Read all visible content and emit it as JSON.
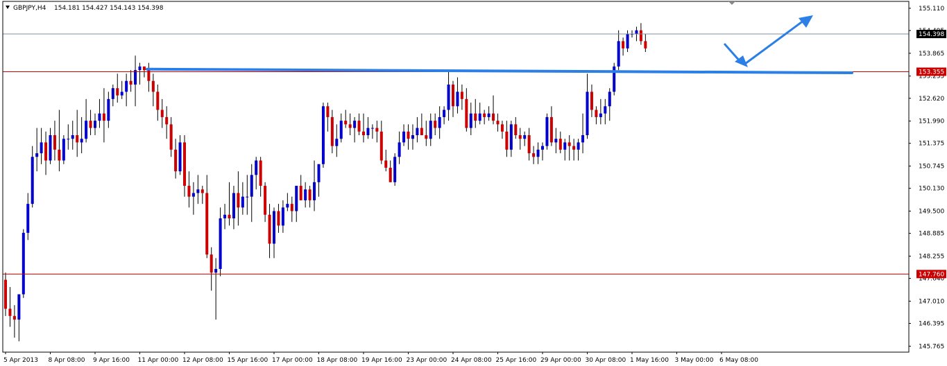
{
  "header": {
    "symbol_tf": "GBPJPY,H4",
    "ohlc": "154.181 154.427 154.143 154.398"
  },
  "colors": {
    "bull": "#0000cc",
    "bear": "#cc0000",
    "wick": "#000000",
    "level_line": "#cc0000",
    "current_line": "#7f8c99",
    "trend": "#2b7fe6",
    "level_label_bg": "#cc0000",
    "price_label_bg": "#000000"
  },
  "chart_data": {
    "type": "candlestick",
    "symbol": "GBPJPY",
    "timeframe": "H4",
    "ylim": [
      145.6,
      155.3
    ],
    "y_ticks": [
      "155.110",
      "154.495",
      "153.865",
      "153.235",
      "152.620",
      "151.990",
      "151.375",
      "150.745",
      "150.130",
      "149.500",
      "148.885",
      "148.255",
      "147.640",
      "147.010",
      "146.395",
      "145.765"
    ],
    "x_labels": [
      "5 Apr 2013",
      "8 Apr 08:00",
      "9 Apr 16:00",
      "11 Apr 00:00",
      "12 Apr 08:00",
      "15 Apr 16:00",
      "17 Apr 00:00",
      "18 Apr 08:00",
      "19 Apr 16:00",
      "23 Apr 00:00",
      "24 Apr 08:00",
      "25 Apr 16:00",
      "29 Apr 00:00",
      "30 Apr 08:00",
      "1 May 16:00",
      "3 May 00:00",
      "6 May 08:00"
    ],
    "levels": [
      {
        "value": 153.355,
        "label": "153.355"
      },
      {
        "value": 147.76,
        "label": "147.760"
      }
    ],
    "current_price": {
      "value": 154.398,
      "label": "154.398"
    },
    "candles": [
      [
        147.6,
        147.8,
        146.6,
        146.8
      ],
      [
        146.8,
        147.4,
        146.3,
        146.6
      ],
      [
        146.6,
        146.9,
        146.0,
        146.5
      ],
      [
        146.5,
        147.2,
        145.9,
        147.2
      ],
      [
        147.2,
        149.0,
        147.1,
        148.9
      ],
      [
        148.9,
        150.0,
        148.7,
        149.7
      ],
      [
        149.7,
        151.3,
        149.6,
        151.0
      ],
      [
        151.0,
        151.8,
        150.6,
        151.1
      ],
      [
        151.1,
        151.8,
        150.8,
        151.4
      ],
      [
        151.4,
        151.7,
        150.5,
        150.9
      ],
      [
        150.9,
        151.8,
        150.8,
        151.6
      ],
      [
        151.6,
        152.0,
        150.9,
        151.2
      ],
      [
        151.2,
        152.3,
        150.6,
        150.9
      ],
      [
        150.9,
        151.6,
        150.8,
        151.5
      ],
      [
        151.5,
        151.9,
        151.2,
        151.5
      ],
      [
        151.5,
        152.0,
        151.2,
        151.6
      ],
      [
        151.6,
        152.3,
        151.0,
        151.4
      ],
      [
        151.4,
        152.1,
        151.1,
        151.5
      ],
      [
        151.5,
        152.6,
        151.4,
        152.0
      ],
      [
        152.0,
        152.3,
        151.6,
        151.8
      ],
      [
        151.8,
        152.2,
        151.6,
        152.0
      ],
      [
        152.0,
        152.6,
        151.8,
        152.2
      ],
      [
        152.2,
        152.9,
        151.4,
        152.0
      ],
      [
        152.0,
        152.8,
        151.8,
        152.6
      ],
      [
        152.6,
        153.0,
        152.4,
        152.9
      ],
      [
        152.9,
        153.3,
        152.5,
        152.7
      ],
      [
        152.7,
        153.1,
        152.6,
        152.8
      ],
      [
        152.8,
        153.3,
        152.4,
        153.1
      ],
      [
        153.1,
        153.4,
        152.8,
        153.0
      ],
      [
        153.0,
        153.8,
        152.4,
        153.4
      ],
      [
        153.4,
        153.6,
        153.0,
        153.5
      ],
      [
        153.5,
        153.5,
        153.2,
        153.4
      ],
      [
        153.4,
        153.6,
        152.8,
        153.1
      ],
      [
        153.1,
        153.3,
        152.4,
        152.8
      ],
      [
        152.8,
        153.0,
        152.0,
        152.3
      ],
      [
        152.3,
        152.6,
        151.8,
        152.1
      ],
      [
        152.1,
        152.4,
        151.5,
        151.9
      ],
      [
        151.9,
        152.1,
        151.0,
        151.2
      ],
      [
        151.2,
        151.5,
        150.4,
        150.6
      ],
      [
        150.6,
        151.6,
        150.5,
        151.4
      ],
      [
        151.4,
        151.6,
        149.9,
        150.2
      ],
      [
        150.2,
        150.6,
        149.6,
        149.9
      ],
      [
        149.9,
        150.3,
        149.4,
        150.0
      ],
      [
        150.0,
        150.5,
        149.7,
        150.1
      ],
      [
        150.1,
        150.2,
        149.7,
        150.0
      ],
      [
        150.0,
        150.5,
        148.2,
        148.3
      ],
      [
        148.3,
        148.5,
        147.3,
        147.8
      ],
      [
        147.8,
        148.2,
        146.5,
        147.9
      ],
      [
        147.9,
        149.6,
        147.7,
        149.3
      ],
      [
        149.3,
        149.7,
        149.0,
        149.4
      ],
      [
        149.4,
        150.3,
        149.1,
        149.3
      ],
      [
        149.3,
        150.2,
        149.0,
        150.0
      ],
      [
        150.0,
        150.6,
        149.1,
        149.6
      ],
      [
        149.6,
        150.3,
        149.4,
        149.9
      ],
      [
        149.9,
        150.5,
        149.4,
        149.9
      ],
      [
        149.9,
        150.8,
        149.2,
        150.5
      ],
      [
        150.5,
        151.0,
        150.1,
        150.9
      ],
      [
        150.9,
        151.0,
        149.9,
        150.2
      ],
      [
        150.2,
        150.3,
        149.2,
        149.4
      ],
      [
        149.4,
        149.7,
        148.2,
        148.6
      ],
      [
        148.6,
        149.6,
        148.2,
        149.5
      ],
      [
        149.5,
        149.7,
        148.9,
        149.1
      ],
      [
        149.1,
        149.8,
        148.9,
        149.6
      ],
      [
        149.6,
        150.0,
        149.5,
        149.7
      ],
      [
        149.7,
        149.9,
        149.2,
        149.5
      ],
      [
        149.5,
        150.2,
        149.2,
        150.2
      ],
      [
        150.2,
        150.5,
        149.8,
        149.8
      ],
      [
        149.8,
        150.3,
        149.6,
        150.1
      ],
      [
        150.1,
        150.2,
        149.6,
        149.8
      ],
      [
        149.8,
        150.9,
        149.5,
        150.3
      ],
      [
        150.3,
        150.6,
        149.9,
        150.8
      ],
      [
        150.8,
        152.5,
        150.7,
        152.4
      ],
      [
        152.4,
        152.5,
        151.7,
        152.1
      ],
      [
        152.1,
        152.3,
        151.1,
        151.3
      ],
      [
        151.3,
        151.9,
        151.0,
        151.5
      ],
      [
        151.5,
        152.2,
        151.4,
        152.0
      ],
      [
        152.0,
        152.3,
        151.8,
        151.9
      ],
      [
        151.9,
        152.2,
        151.6,
        151.8
      ],
      [
        151.8,
        152.1,
        151.4,
        152.0
      ],
      [
        152.0,
        152.2,
        151.6,
        151.7
      ],
      [
        151.7,
        152.2,
        151.4,
        151.6
      ],
      [
        151.6,
        152.1,
        151.5,
        151.8
      ],
      [
        151.8,
        151.9,
        151.5,
        151.8
      ],
      [
        151.8,
        152.0,
        151.4,
        151.7
      ],
      [
        151.7,
        152.0,
        150.8,
        150.9
      ],
      [
        150.9,
        151.2,
        150.6,
        150.7
      ],
      [
        150.7,
        150.9,
        150.3,
        150.3
      ],
      [
        150.3,
        151.1,
        150.2,
        151.0
      ],
      [
        151.0,
        151.7,
        150.8,
        151.4
      ],
      [
        151.4,
        151.9,
        151.3,
        151.7
      ],
      [
        151.7,
        151.9,
        151.2,
        151.5
      ],
      [
        151.5,
        151.9,
        151.2,
        151.6
      ],
      [
        151.6,
        152.1,
        151.4,
        151.8
      ],
      [
        151.8,
        152.2,
        151.6,
        151.6
      ],
      [
        151.6,
        152.0,
        151.3,
        151.5
      ],
      [
        151.5,
        152.2,
        151.3,
        152.0
      ],
      [
        152.0,
        152.2,
        151.6,
        151.8
      ],
      [
        151.8,
        152.4,
        151.5,
        152.1
      ],
      [
        152.1,
        152.4,
        151.9,
        152.3
      ],
      [
        152.3,
        153.4,
        152.0,
        153.0
      ],
      [
        153.0,
        153.1,
        152.1,
        152.4
      ],
      [
        152.4,
        153.2,
        152.2,
        152.8
      ],
      [
        152.8,
        153.0,
        152.3,
        152.6
      ],
      [
        152.6,
        152.9,
        151.7,
        151.8
      ],
      [
        151.8,
        152.5,
        151.6,
        152.2
      ],
      [
        152.2,
        152.6,
        151.8,
        152.0
      ],
      [
        152.0,
        152.5,
        151.9,
        152.2
      ],
      [
        152.2,
        152.3,
        151.9,
        152.1
      ],
      [
        152.1,
        152.4,
        152.0,
        152.2
      ],
      [
        152.2,
        152.7,
        151.9,
        152.0
      ],
      [
        152.0,
        152.2,
        151.7,
        151.9
      ],
      [
        151.9,
        152.0,
        151.5,
        151.7
      ],
      [
        151.7,
        152.0,
        151.0,
        151.2
      ],
      [
        151.2,
        152.0,
        151.0,
        151.9
      ],
      [
        151.9,
        152.1,
        151.5,
        151.6
      ],
      [
        151.6,
        151.8,
        151.2,
        151.5
      ],
      [
        151.5,
        151.7,
        151.3,
        151.6
      ],
      [
        151.6,
        151.8,
        150.9,
        151.1
      ],
      [
        151.1,
        151.3,
        150.8,
        151.0
      ],
      [
        151.0,
        151.4,
        150.8,
        151.2
      ],
      [
        151.2,
        151.4,
        150.9,
        151.3
      ],
      [
        151.3,
        152.2,
        151.2,
        152.1
      ],
      [
        152.1,
        152.4,
        151.3,
        151.4
      ],
      [
        151.4,
        151.8,
        151.1,
        151.5
      ],
      [
        151.5,
        151.7,
        151.1,
        151.2
      ],
      [
        151.2,
        151.5,
        150.9,
        151.4
      ],
      [
        151.4,
        151.6,
        150.9,
        151.3
      ],
      [
        151.3,
        151.5,
        150.9,
        151.2
      ],
      [
        151.2,
        151.5,
        150.9,
        151.4
      ],
      [
        151.4,
        152.2,
        151.1,
        151.6
      ],
      [
        151.6,
        153.3,
        151.5,
        152.8
      ],
      [
        152.8,
        153.0,
        152.1,
        152.3
      ],
      [
        152.3,
        152.4,
        151.9,
        152.1
      ],
      [
        152.1,
        152.6,
        151.9,
        152.2
      ],
      [
        152.2,
        152.6,
        151.9,
        152.4
      ],
      [
        152.4,
        152.9,
        152.0,
        152.8
      ],
      [
        152.8,
        153.6,
        152.7,
        153.5
      ],
      [
        153.5,
        154.5,
        153.4,
        154.2
      ],
      [
        154.2,
        154.3,
        153.8,
        154.0
      ],
      [
        154.0,
        154.5,
        153.9,
        154.4
      ],
      [
        154.4,
        154.5,
        154.3,
        154.4
      ],
      [
        154.4,
        154.6,
        154.2,
        154.5
      ],
      [
        154.5,
        154.7,
        154.1,
        154.2
      ],
      [
        154.2,
        154.4,
        153.9,
        154.0
      ]
    ]
  }
}
